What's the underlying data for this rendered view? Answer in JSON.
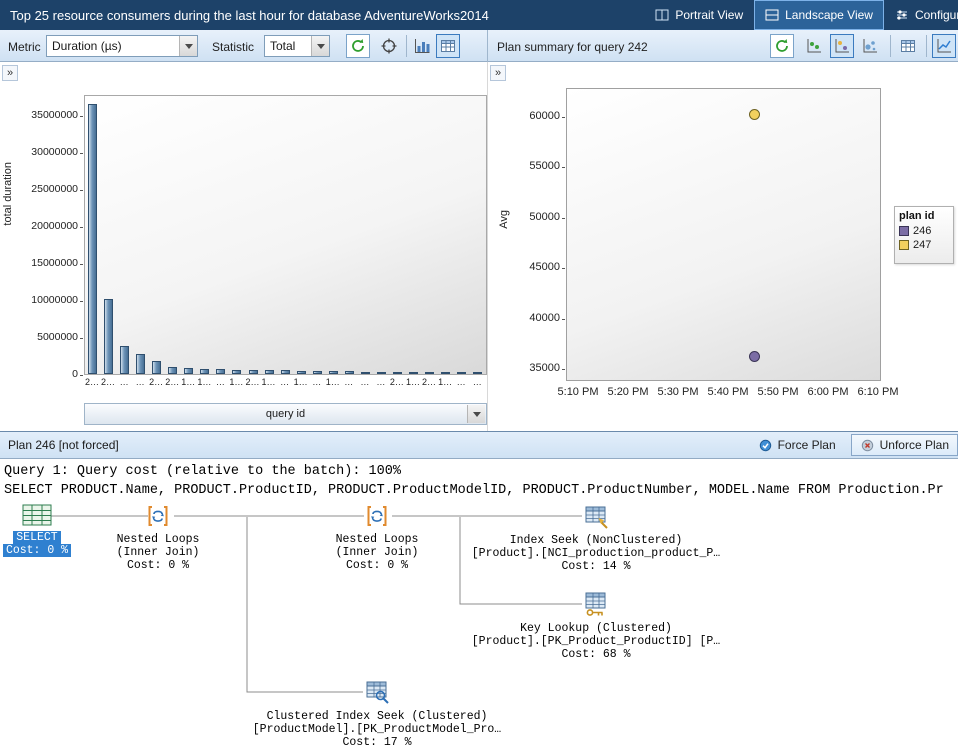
{
  "header": {
    "title": "Top 25 resource consumers during the last hour for database AdventureWorks2014",
    "portrait_button": "Portrait View",
    "landscape_button": "Landscape View",
    "configure_button": "Configure"
  },
  "toolbar": {
    "metric_label": "Metric",
    "metric_value": "Duration (µs)",
    "statistic_label": "Statistic",
    "statistic_value": "Total",
    "plan_summary_label": "Plan summary for query 242",
    "left_icons": [
      "refresh-icon",
      "track-query-icon",
      "chart-view-icon",
      "grid-view-icon"
    ],
    "right_icons": [
      "refresh-icon",
      "scatter-chart-icon",
      "scatter-chart-selected-icon",
      "bubble-chart-icon",
      "grid-view-icon",
      "line-chart-icon"
    ]
  },
  "panes": {
    "expand_chevron": "»"
  },
  "plan_bar": {
    "title": "Plan 246 [not forced]",
    "force_button": "Force Plan",
    "unforce_button": "Unforce Plan"
  },
  "query_pane": {
    "line1": "Query 1: Query cost (relative to the batch): 100%",
    "line2": "SELECT PRODUCT.Name, PRODUCT.ProductID, PRODUCT.ProductModelID, PRODUCT.ProductNumber, MODEL.Name FROM Production.Pr"
  },
  "plan_nodes": {
    "select": {
      "lines": [
        "SELECT",
        "Cost: 0 %"
      ]
    },
    "nested_loops_1": {
      "lines": [
        "Nested Loops",
        "(Inner Join)",
        "Cost: 0 %"
      ]
    },
    "nested_loops_2": {
      "lines": [
        "Nested Loops",
        "(Inner Join)",
        "Cost: 0 %"
      ]
    },
    "index_seek": {
      "lines": [
        "Index Seek (NonClustered)",
        "[Product].[NCI_production_product_P…",
        "Cost: 14 %"
      ]
    },
    "key_lookup": {
      "lines": [
        "Key Lookup (Clustered)",
        "[Product].[PK_Product_ProductID] [P…",
        "Cost: 68 %"
      ]
    },
    "clustered_index_seek": {
      "lines": [
        "Clustered Index Seek (Clustered)",
        "[ProductModel].[PK_ProductModel_Pro…",
        "Cost: 17 %"
      ]
    }
  },
  "chart_data": [
    {
      "type": "bar",
      "title": "",
      "xlabel": "query id",
      "ylabel": "total duration",
      "ylim": [
        0,
        37800000
      ],
      "ytick_step": 5000000,
      "yticks": [
        0,
        5000000,
        10000000,
        15000000,
        20000000,
        25000000,
        30000000,
        35000000
      ],
      "categories": [
        "2…",
        "2…",
        "…",
        "…",
        "2…",
        "2…",
        "1…",
        "1…",
        "…",
        "1…",
        "2…",
        "1…",
        "…",
        "1…",
        "…",
        "1…",
        "…",
        "…",
        "…",
        "2…",
        "1…",
        "2…",
        "1…",
        "…",
        "…"
      ],
      "values": [
        36500000,
        10100000,
        3800000,
        2700000,
        1700000,
        900000,
        800000,
        720000,
        660000,
        610000,
        560000,
        520000,
        480000,
        450000,
        420000,
        390000,
        360000,
        340000,
        320000,
        300000,
        280000,
        260000,
        240000,
        230000,
        220000
      ]
    },
    {
      "type": "scatter",
      "title": "",
      "xlabel": "",
      "ylabel": "Avg",
      "ylim": [
        35000,
        62500
      ],
      "yticks": [
        35000,
        40000,
        45000,
        50000,
        55000,
        60000
      ],
      "xticks": [
        "5:10 PM",
        "5:20 PM",
        "5:30 PM",
        "5:40 PM",
        "5:50 PM",
        "6:00 PM",
        "6:10 PM"
      ],
      "legend_title": "plan id",
      "legend_position": "right",
      "series": [
        {
          "name": "246",
          "color": "#7b6da5",
          "border": "#3a3456",
          "points": [
            {
              "x": "5:45 PM",
              "y": 36300
            }
          ]
        },
        {
          "name": "247",
          "color": "#f2d05e",
          "border": "#6e6222",
          "points": [
            {
              "x": "5:45 PM",
              "y": 60300
            }
          ]
        }
      ]
    }
  ],
  "colors": {
    "titlebar": "#1d4269",
    "selected_node": "#2f80d0",
    "bar_fill": "#476f94",
    "plan_246": "#7b6da5",
    "plan_247": "#f2d05e"
  }
}
